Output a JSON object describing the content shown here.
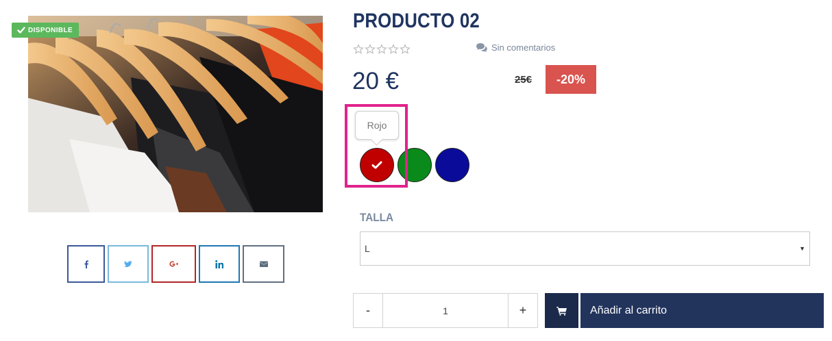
{
  "product": {
    "title": "PRODUCTO 02",
    "stock_badge": "DISPONIBLE",
    "rating_stars_filled": 0,
    "rating_stars_total": 5,
    "comments_label": "Sin comentarios",
    "price": "20 €",
    "old_price": "25€",
    "discount": "-20%"
  },
  "colors": {
    "tooltip": "Rojo",
    "swatches": [
      {
        "name": "Rojo",
        "hex": "#c00000",
        "selected": true
      },
      {
        "name": "Verde",
        "hex": "#0a8a1a",
        "selected": false
      },
      {
        "name": "Azul",
        "hex": "#0b0b9a",
        "selected": false
      }
    ],
    "highlight_color": "#e0238c"
  },
  "size": {
    "label": "TALLA",
    "selected": "L"
  },
  "cart": {
    "qty_minus": "-",
    "qty_value": "1",
    "qty_plus": "+",
    "add_label": "Añadir al carrito"
  },
  "share": [
    "facebook-icon",
    "twitter-icon",
    "google-plus-icon",
    "linkedin-icon",
    "envelope-icon"
  ],
  "theme": {
    "accent": "#1f3460",
    "discount": "#d9534f",
    "available": "#5cb85c",
    "cart_button": "#22345c"
  }
}
